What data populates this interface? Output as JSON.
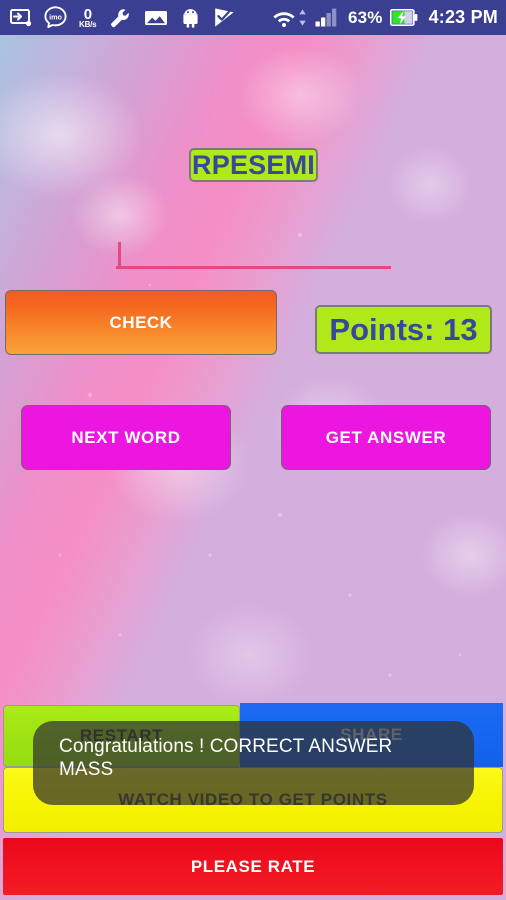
{
  "status_bar": {
    "background_color": "#3b3f91",
    "icons": [
      {
        "name": "screen-cast-icon",
        "glyph": "cast"
      },
      {
        "name": "imo-app-icon",
        "glyph": "imo"
      },
      {
        "name": "data-rate-icon",
        "value": "0",
        "unit": "KB/s"
      },
      {
        "name": "wrench-settings-icon",
        "glyph": "wrench"
      },
      {
        "name": "gallery-image-icon",
        "glyph": "image"
      },
      {
        "name": "android-robot-icon",
        "glyph": "android"
      },
      {
        "name": "checkmark-flag-icon",
        "glyph": "flag-check"
      }
    ],
    "wifi_icon": "wifi-icon",
    "signal_icon": "cellular-signal-icon",
    "battery_percent": "63%",
    "battery_icon": "battery-charging-icon",
    "time": "4:23 PM"
  },
  "game": {
    "scrambled_word": "RPESEMI",
    "word_bg_color": "#b0e81a",
    "word_text_color": "#36499a",
    "answer_input": {
      "value": "",
      "placeholder": "",
      "underline_color": "#e44a7e"
    },
    "check_button": {
      "label": "CHECK",
      "color": "#f8872a"
    },
    "points": {
      "label": "Points: 13",
      "bg_color": "#b0e81a",
      "text_color": "#36499a"
    },
    "next_word_button": {
      "label": "NEXT WORD",
      "color": "#ed15e0"
    },
    "get_answer_button": {
      "label": "GET ANSWER",
      "color": "#ed15e0"
    }
  },
  "bottom_bar": {
    "restart_button": {
      "label": "RESTART",
      "color": "#9ae60c"
    },
    "share_button": {
      "label": "SHARE",
      "color": "#1566f0"
    },
    "watch_video_button": {
      "label": "WATCH VIDEO TO GET POINTS",
      "color": "#f7f401"
    },
    "rate_button": {
      "label": "PLEASE RATE",
      "color": "#f1101f"
    }
  },
  "toast": {
    "line1": "Congratulations ! CORRECT ANSWER",
    "line2": "MASS",
    "background_color": "rgba(48,48,48,0.72)",
    "text_color": "#ffffff"
  }
}
